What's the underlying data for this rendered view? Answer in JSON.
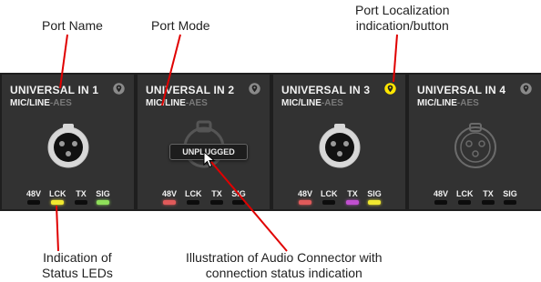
{
  "annotations": {
    "port_name": "Port Name",
    "port_mode": "Port Mode",
    "localization_line1": "Port Localization",
    "localization_line2": "indication/button",
    "leds_line1": "Indication of",
    "leds_line2": "Status LEDs",
    "connector_line1": "Illustration of Audio Connector with",
    "connector_line2": "connection status indication"
  },
  "led_labels": [
    "48V",
    "LCK",
    "TX",
    "SIG"
  ],
  "colors": {
    "led_off": "#0c0c0c",
    "led_red": "#e05a5a",
    "led_yellow": "#f0e830",
    "led_green": "#8fe05a",
    "led_magenta": "#c14fd0",
    "locate_active": "#ffe600",
    "locate_inactive": "#8a8a8a"
  },
  "ports": [
    {
      "name": "UNIVERSAL IN 1",
      "mode_active": "MIC/LINE",
      "mode_inactive": "-AES",
      "connector": "xlr-plugged",
      "locate_active": false,
      "leds": [
        "#0c0c0c",
        "#f0e830",
        "#0c0c0c",
        "#8fe05a"
      ]
    },
    {
      "name": "UNIVERSAL IN 2",
      "mode_active": "MIC/LINE",
      "mode_inactive": "-AES",
      "connector": "unplugged",
      "status": "UNPLUGGED",
      "locate_active": false,
      "leds": [
        "#e05a5a",
        "#0c0c0c",
        "#0c0c0c",
        "#0c0c0c"
      ]
    },
    {
      "name": "UNIVERSAL IN 3",
      "mode_active": "MIC/LINE",
      "mode_inactive": "-AES",
      "connector": "xlr-plugged",
      "locate_active": true,
      "leds": [
        "#e05a5a",
        "#0c0c0c",
        "#c14fd0",
        "#f0e830"
      ]
    },
    {
      "name": "UNIVERSAL IN 4",
      "mode_active": "MIC/LINE",
      "mode_inactive": "-AES",
      "connector": "xlr-outline",
      "locate_active": false,
      "leds": [
        "#0c0c0c",
        "#0c0c0c",
        "#0c0c0c",
        "#0c0c0c"
      ]
    }
  ]
}
